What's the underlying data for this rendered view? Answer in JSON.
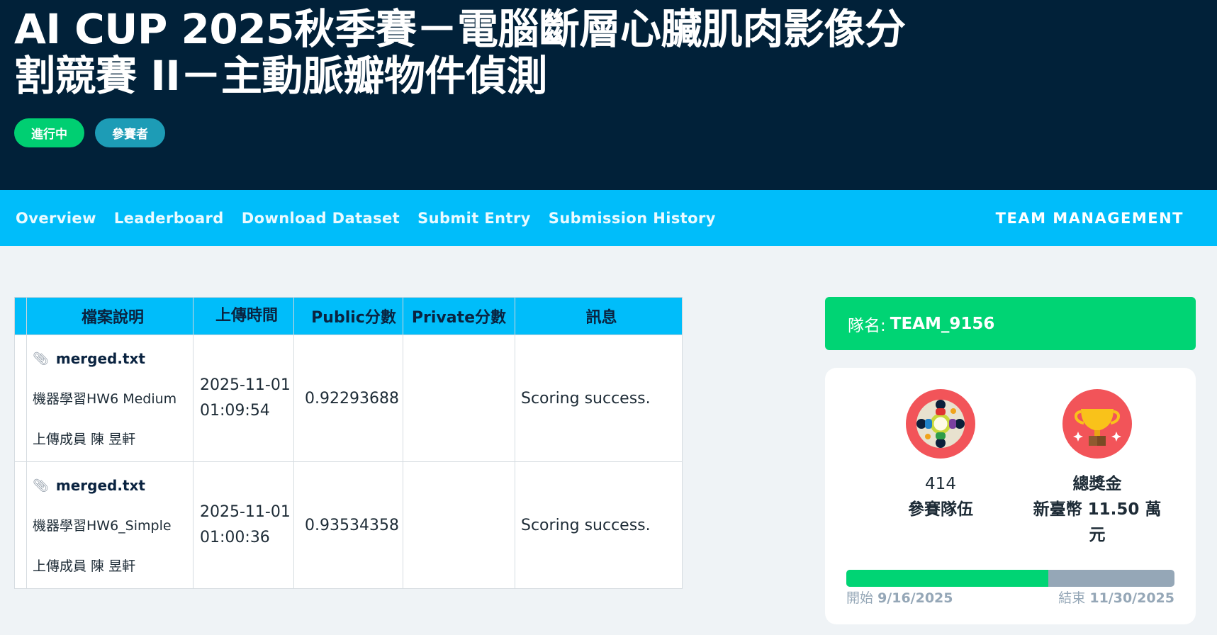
{
  "header": {
    "title": "AI CUP 2025秋季賽－電腦斷層心臟肌肉影像分割競賽 II－主動脈瓣物件偵測",
    "status_badge": "進行中",
    "role_badge": "參賽者"
  },
  "nav": {
    "items": [
      "Overview",
      "Leaderboard",
      "Download Dataset",
      "Submit Entry",
      "Submission History"
    ],
    "team_management": "TEAM MANAGEMENT"
  },
  "table": {
    "columns": [
      "檔案說明",
      "上傳時間",
      "Public分數",
      "Private分數",
      "訊息"
    ],
    "rows": [
      {
        "file_name": "merged.txt",
        "description": "機器學習HW6 Medium",
        "uploader": "上傳成員 陳 昱軒",
        "date": "2025-11-01",
        "time": "01:09:54",
        "public_score": "0.92293688",
        "private_score": "",
        "message": "Scoring success."
      },
      {
        "file_name": "merged.txt",
        "description": "機器學習HW6_Simple",
        "uploader": "上傳成員 陳 昱軒",
        "date": "2025-11-01",
        "time": "01:00:36",
        "public_score": "0.93534358",
        "private_score": "",
        "message": "Scoring success."
      }
    ]
  },
  "team": {
    "label": "隊名:",
    "name": "TEAM_9156"
  },
  "stats": {
    "teams_value": "414",
    "teams_label": "參賽隊伍",
    "prize_label": "總獎金",
    "prize_value": "新臺幣 11.50 萬元",
    "progress_fraction": 0.615,
    "start_label": "開始",
    "start_date": "9/16/2025",
    "end_label": "結束",
    "end_date": "11/30/2025"
  },
  "colors": {
    "header_bg": "#012139",
    "nav_bg": "#00bdfa",
    "accent_green": "#00d474",
    "role_badge": "#1d9cb6",
    "icon_bg": "#f25459"
  },
  "icons": {
    "attachment": "paperclip-icon",
    "teams": "teams-circle-icon",
    "prize": "trophy-icon"
  }
}
